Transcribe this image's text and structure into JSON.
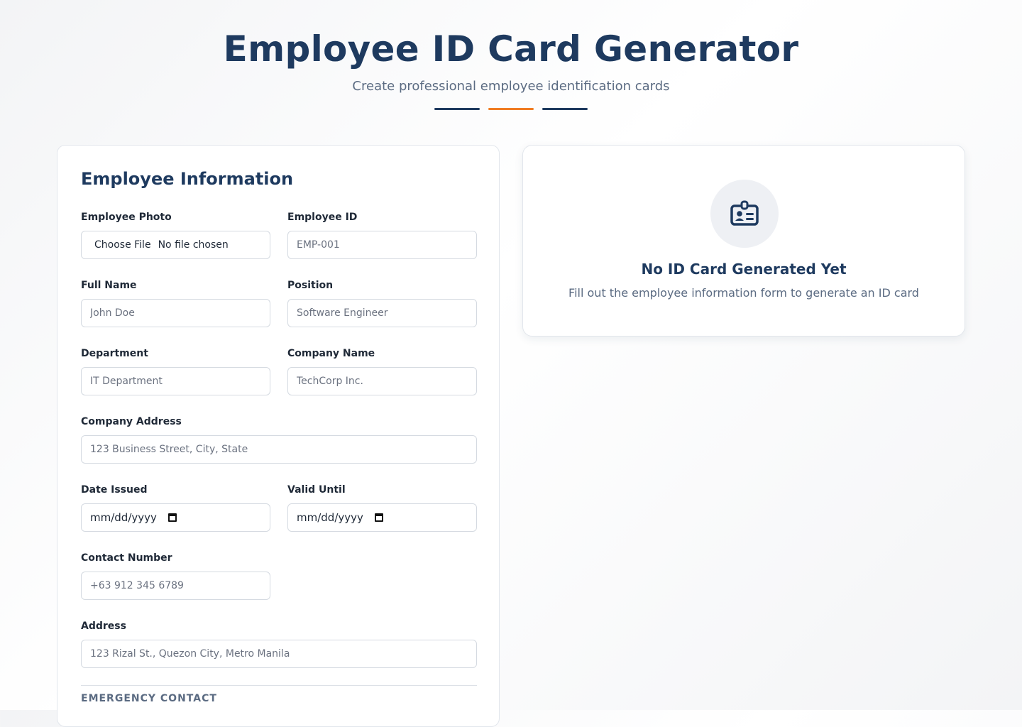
{
  "header": {
    "title": "Employee ID Card Generator",
    "subtitle": "Create professional employee identification cards"
  },
  "form": {
    "title": "Employee Information",
    "photo": {
      "label": "Employee Photo",
      "button": "Choose File",
      "status": "No file chosen"
    },
    "employee_id": {
      "label": "Employee ID",
      "placeholder": "EMP-001"
    },
    "full_name": {
      "label": "Full Name",
      "placeholder": "John Doe"
    },
    "position": {
      "label": "Position",
      "placeholder": "Software Engineer"
    },
    "department": {
      "label": "Department",
      "placeholder": "IT Department"
    },
    "company_name": {
      "label": "Company Name",
      "placeholder": "TechCorp Inc."
    },
    "company_address": {
      "label": "Company Address",
      "placeholder": "123 Business Street, City, State"
    },
    "date_issued": {
      "label": "Date Issued",
      "value_text": "mm/dd/yyyy"
    },
    "valid_until": {
      "label": "Valid Until",
      "value_text": "mm/dd/yyyy"
    },
    "contact_number": {
      "label": "Contact Number",
      "placeholder": "+63 912 345 6789"
    },
    "address": {
      "label": "Address",
      "placeholder": "123 Rizal St., Quezon City, Metro Manila"
    },
    "emergency_section": "EMERGENCY CONTACT"
  },
  "preview": {
    "icon": "id-card-icon",
    "title": "No ID Card Generated Yet",
    "text": "Fill out the employee information form to generate an ID card"
  },
  "colors": {
    "primary": "#1e3a5f",
    "accent": "#f07c23",
    "muted": "#5b6b82"
  }
}
